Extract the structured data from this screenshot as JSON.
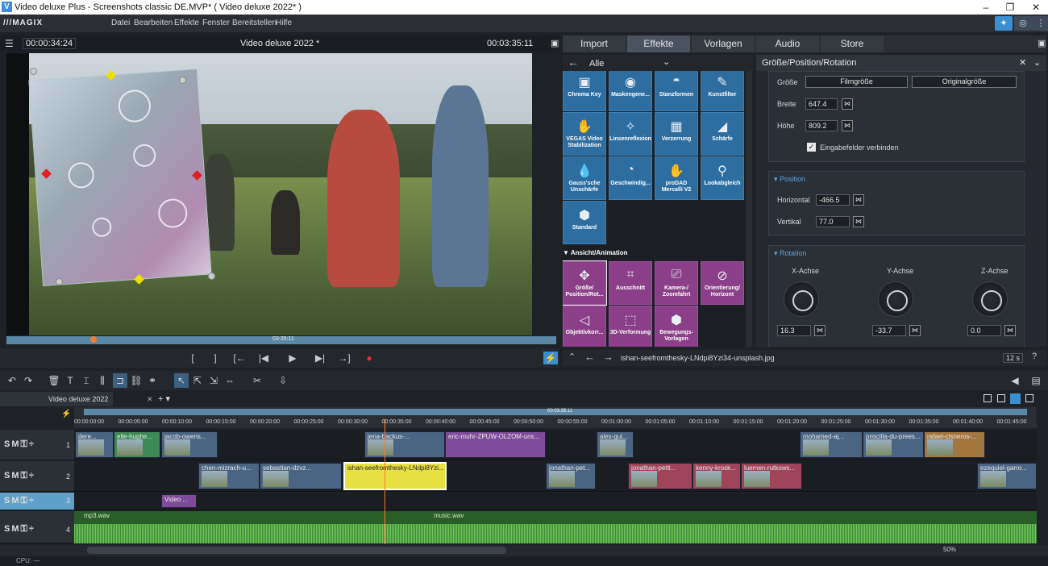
{
  "window": {
    "title": "Video deluxe Plus - Screenshots classic DE.MVP* ( Video deluxe 2022* )"
  },
  "menu": {
    "brand": "///MAGIX",
    "items": [
      "Datei",
      "Bearbeiten",
      "Effekte",
      "Fenster",
      "Bereitstellen",
      "Hilfe"
    ]
  },
  "preview": {
    "timecode_left": "00:00:34:24",
    "title": "Video deluxe 2022 *",
    "timecode_right": "00:03:35:11",
    "scrub_time": "03:35:11"
  },
  "media_tabs": [
    "Import",
    "Effekte",
    "Vorlagen",
    "Audio",
    "Store"
  ],
  "active_tab": "Effekte",
  "effects": {
    "filter": "Alle",
    "row1": [
      "Chroma Key",
      "Maskengene...",
      "Stanzformen",
      "Kunstfilter"
    ],
    "row2": [
      "VEGAS Video Stabilization",
      "Linsenreflexion",
      "Verzerrung",
      "Schärfe"
    ],
    "row3": [
      "Gauss'sche Unschärfe",
      "Geschwindig...",
      "proDAD Mercalli V2",
      "Lookabgleich"
    ],
    "row4": [
      "Standard"
    ],
    "section": "Ansicht/Animation",
    "row5": [
      "Größe/ Position/Rot...",
      "Ausschnitt",
      "Kamera-/ Zoomfahrt",
      "Orientierung/ Horizont"
    ],
    "row6": [
      "Objektivkorr...",
      "3D-Verformung",
      "Bewegungs- Vorlagen"
    ]
  },
  "properties": {
    "title": "Größe/Position/Rotation",
    "groesse_label": "Größe",
    "btn_filmgroesse": "Filmgröße",
    "btn_originalgroesse": "Originalgröße",
    "breite_label": "Breite",
    "breite": "647.4",
    "hoehe_label": "Höhe",
    "hoehe": "809.2",
    "link_label": "Eingabefelder verbinden",
    "position_title": "Position",
    "horizontal_label": "Horizontal",
    "horizontal": "-466.5",
    "vertikal_label": "Vertikal",
    "vertikal": "77.0",
    "rotation_title": "Rotation",
    "x_label": "X-Achse",
    "x": "16.3",
    "y_label": "Y-Achse",
    "y": "-33.7",
    "z_label": "Z-Achse",
    "z": "0.0"
  },
  "prop_footer": {
    "filename": "ishan-seefromthesky-LNdpi8Yzi34-unsplash.jpg",
    "duration": "12 s"
  },
  "timeline": {
    "project_tab": "Video deluxe 2022",
    "ruler_marker": "00:03:35:11",
    "ticks": [
      "00:00:00:00",
      "00:00:05:00",
      "00:00:10:00",
      "00:00:15:00",
      "00:00:20:00",
      "00:00:25:00",
      "00:00:30:00",
      "00:00:35:00",
      "00:00:40:00",
      "00:00:45:00",
      "00:00:50:00",
      "00:00:55:00",
      "00:01:00:00",
      "00:01:05:00",
      "00:01:10:00",
      "00:01:15:00",
      "00:01:20:00",
      "00:01:25:00",
      "00:01:30:00",
      "00:01:35:00",
      "00:01:40:00",
      "00:01:45:00"
    ],
    "track_numbers": [
      "1",
      "2",
      "3",
      "4"
    ],
    "track1_clips": [
      "dere...",
      "elle-hughe...",
      "jacob-owens...",
      "jena-backus-...",
      "eric-muhr-ZPUW-OLZOM-uns...",
      "alex-gui...",
      "mohamed-aj...",
      "priscilla-du-prees...",
      "rafael-cisneros-..."
    ],
    "track2_clips": [
      "chen-mizrach-u...",
      "sebastian-dzvz...",
      "ishan-seefromthesky-LNdpi8Yzi...",
      "jonathan-pet...",
      "jonathan-petit...",
      "kenny-krosk...",
      "luemen-rutkows...",
      "ezequiel-garro..."
    ],
    "track3_clips": [
      "Video ..."
    ],
    "audio_clips": [
      "mp3.wav",
      "music.wav"
    ],
    "zoom": "50%"
  },
  "status": {
    "cpu": "CPU: —"
  }
}
